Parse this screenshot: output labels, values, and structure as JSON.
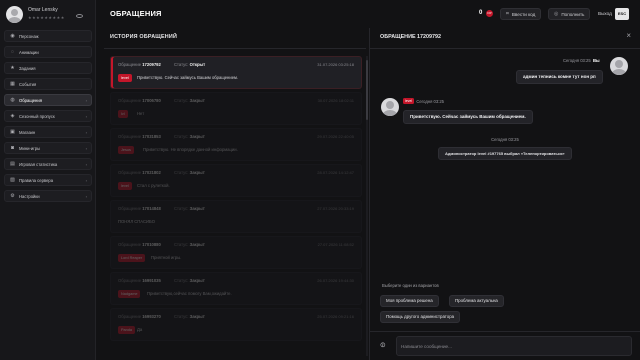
{
  "profile": {
    "name": "Omar Lensky",
    "stars": "★★★★★★★★★"
  },
  "nav": [
    {
      "label": "Персонаж",
      "icon": "person-icon",
      "glyph": "◉",
      "active": false
    },
    {
      "label": "Анимации",
      "icon": "animation-icon",
      "glyph": "◌",
      "active": false
    },
    {
      "label": "Задания",
      "icon": "star-icon",
      "glyph": "★",
      "active": false
    },
    {
      "label": "События",
      "icon": "calendar-icon",
      "glyph": "▦",
      "active": false
    },
    {
      "label": "Обращения",
      "icon": "support-icon",
      "glyph": "◍",
      "active": true
    },
    {
      "label": "Сезонный пропуск",
      "icon": "battlepass-icon",
      "glyph": "◈",
      "active": false
    },
    {
      "label": "Магазин",
      "icon": "cart-icon",
      "glyph": "▣",
      "active": false
    },
    {
      "label": "Мини-игры",
      "icon": "gamepad-icon",
      "glyph": "◙",
      "active": false
    },
    {
      "label": "Игровая статистика",
      "icon": "stats-icon",
      "glyph": "▤",
      "active": false
    },
    {
      "label": "Правила сервера",
      "icon": "rules-icon",
      "glyph": "▧",
      "active": false
    },
    {
      "label": "Настройки",
      "icon": "gear-icon",
      "glyph": "⚙",
      "active": false
    }
  ],
  "header": {
    "title": "ОБРАЩЕНИЯ",
    "balance": "0",
    "coin": "DP",
    "enter_code": "Ввести код",
    "top_up": "Пополнить",
    "exit": "Выход",
    "esc": "ESC"
  },
  "history": {
    "title": "ИСТОРИЯ ОБРАЩЕНИЙ",
    "number_label": "Обращение",
    "status_label": "Статус:",
    "tickets": [
      {
        "number": "17209792",
        "status": "Открыт",
        "date": "31.07.2026 03:25:18",
        "tag": "level",
        "message": "Приветствую. Сейчас займусь Вашим обращением.",
        "active": true
      },
      {
        "number": "17006780",
        "status": "Закрыт",
        "date": "30.07.2026 18:02:11",
        "tag": "lvl",
        "message": "Нет",
        "active": false
      },
      {
        "number": "17031853",
        "status": "Закрыт",
        "date": "29.07.2026 22:40:05",
        "tag": "Jesus",
        "message": "Приветствую. Не впорядке данной информации.",
        "active": false
      },
      {
        "number": "17021802",
        "status": "Закрыт",
        "date": "28.07.2026 14:12:47",
        "tag": "level",
        "message": "Стал с рулеткой.",
        "active": false
      },
      {
        "number": "17014848",
        "status": "Закрыт",
        "date": "27.07.2026 20:33:19",
        "tag": "",
        "message": "ПОНЯЛ СПАСИБО",
        "active": false
      },
      {
        "number": "17010880",
        "status": "Закрыт",
        "date": "27.07.2026 11:08:52",
        "tag": "Lord Reaper",
        "message": "Приятной игры.",
        "active": false
      },
      {
        "number": "16991035",
        "status": "Закрыт",
        "date": "26.07.2026 19:44:30",
        "tag": "Nadgame",
        "message": "Приветствую,сейчас помогу Вам,ожидайте.",
        "active": false
      },
      {
        "number": "16993270",
        "status": "Закрыт",
        "date": "25.07.2026 09:21:16",
        "tag": "Panda",
        "message": "Да",
        "active": false
      }
    ]
  },
  "chat": {
    "title": "ОБРАЩЕНИЕ 17209792",
    "self_time": "Сегодня 03:25",
    "self_name": "Вы",
    "self_message": "админ тепнись комне тут нон рп",
    "admin_badge": "level",
    "admin_time": "Сегодня 03:25",
    "admin_message": "Приветствую. Сейчас займусь Вашим обращением.",
    "system_time": "Сегодня 03:25",
    "system_message": "Администратор level #197765 выбрал «Телепортироваться»",
    "choose_label": "Выберите один из вариантов",
    "options": [
      "Моя проблема решена",
      "Проблема актуальна",
      "Помощь другого администратора"
    ],
    "input_placeholder": "Напишите сообщение..."
  }
}
